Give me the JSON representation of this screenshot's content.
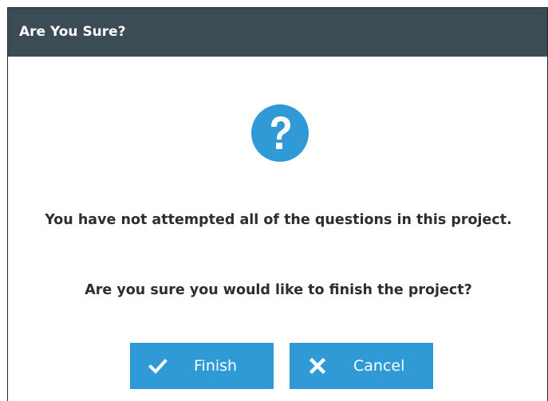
{
  "dialog": {
    "title": "Are You Sure?",
    "icon": "question-circle-icon",
    "message_line1": "You have not attempted all of the questions in this project.",
    "message_line2": "Are you sure you would like to finish the project?"
  },
  "buttons": {
    "finish_label": "Finish",
    "finish_icon": "checkmark-icon",
    "cancel_label": "Cancel",
    "cancel_icon": "x-icon"
  },
  "colors": {
    "titlebar": "#3c4c55",
    "accent": "#2f9ad6",
    "text": "#2e2e2e"
  }
}
